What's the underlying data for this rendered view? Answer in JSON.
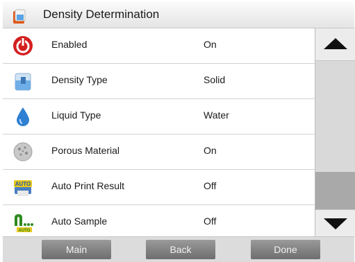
{
  "header": {
    "title": "Density Determination",
    "icon": "density-app-icon"
  },
  "rows": [
    {
      "label": "Enabled",
      "value": "On",
      "icon": "power-icon"
    },
    {
      "label": "Density Type",
      "value": "Solid",
      "icon": "beaker-icon"
    },
    {
      "label": "Liquid Type",
      "value": "Water",
      "icon": "water-drop-icon"
    },
    {
      "label": "Porous Material",
      "value": "On",
      "icon": "porous-stone-icon"
    },
    {
      "label": "Auto Print Result",
      "value": "Off",
      "icon": "auto-printer-icon",
      "icon_text": "AUTO"
    },
    {
      "label": "Auto Sample",
      "value": "Off",
      "icon": "auto-sample-icon",
      "icon_text": "AUTO"
    }
  ],
  "footer": {
    "main_label": "Main",
    "back_label": "Back",
    "done_label": "Done"
  },
  "colors": {
    "power": "#d42020",
    "drop": "#2f7fd2",
    "auto_green": "#2e8b1f",
    "button": "#7f7f7f"
  }
}
